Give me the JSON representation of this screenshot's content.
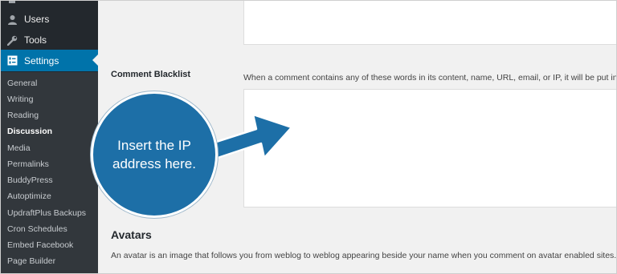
{
  "sidebar": {
    "top_items": [
      {
        "label": "Users",
        "icon": "user-icon"
      },
      {
        "label": "Tools",
        "icon": "wrench-icon"
      },
      {
        "label": "Settings",
        "icon": "settings-icon"
      }
    ],
    "sub_items": [
      "General",
      "Writing",
      "Reading",
      "Discussion",
      "Media",
      "Permalinks",
      "BuddyPress",
      "Autoptimize",
      "UpdraftPlus Backups",
      "Cron Schedules",
      "Embed Facebook",
      "Page Builder"
    ],
    "active_sub_item": "Discussion"
  },
  "main": {
    "comment_blacklist_label": "Comment Blacklist",
    "comment_blacklist_desc": "When a comment contains any of these words in its content, name, URL, email, or IP, it will be put in",
    "avatars_title": "Avatars",
    "avatars_desc": "An avatar is an image that follows you from weblog to weblog appearing beside your name when you comment on avatar enabled sites. Here you"
  },
  "callout": {
    "line1": "Insert the IP",
    "line2": "address here."
  },
  "colors": {
    "sidebar_bg": "#23282d",
    "submenu_bg": "#32373c",
    "accent": "#0073aa",
    "callout": "#1d6fa7"
  }
}
